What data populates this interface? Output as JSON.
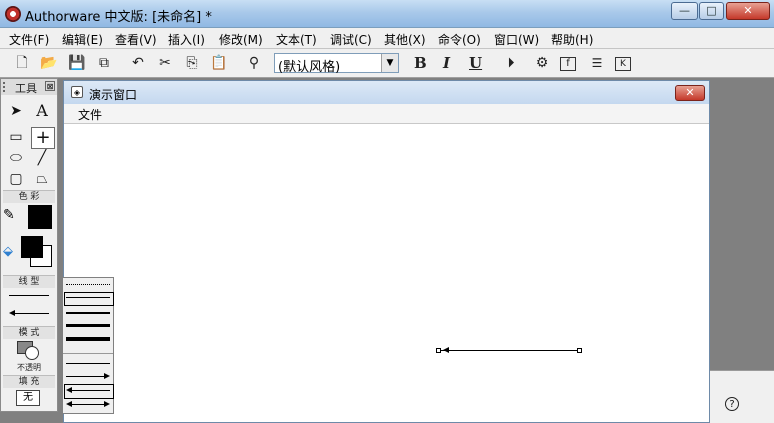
{
  "window": {
    "title": "Authorware 中文版: [未命名] *",
    "buttons": {
      "minimize": "—",
      "maximize": "□",
      "close": "✕"
    }
  },
  "menubar": {
    "items": [
      "文件(F)",
      "编辑(E)",
      "查看(V)",
      "插入(I)",
      "修改(M)",
      "文本(T)",
      "调试(C)",
      "其他(X)",
      "命令(O)",
      "窗口(W)",
      "帮助(H)"
    ]
  },
  "toolbar": {
    "style_select_value": "(默认风格)",
    "bold": "B",
    "italic": "I",
    "underline": "U"
  },
  "presentation_window": {
    "title": "演示窗口",
    "menu_file": "文件",
    "close": "✕"
  },
  "tools_panel": {
    "title": "工具",
    "close": "⊠",
    "section_color": "色 彩",
    "section_line": "线 型",
    "section_mode": "模 式",
    "mode_label": "不透明",
    "section_fill": "填 充",
    "fill_value": "无"
  },
  "help": {
    "icon": "?"
  },
  "colors": {
    "titlebar_gradient": "#a9c9ea",
    "close_red": "#c4382a",
    "workspace_gray": "#808080"
  }
}
